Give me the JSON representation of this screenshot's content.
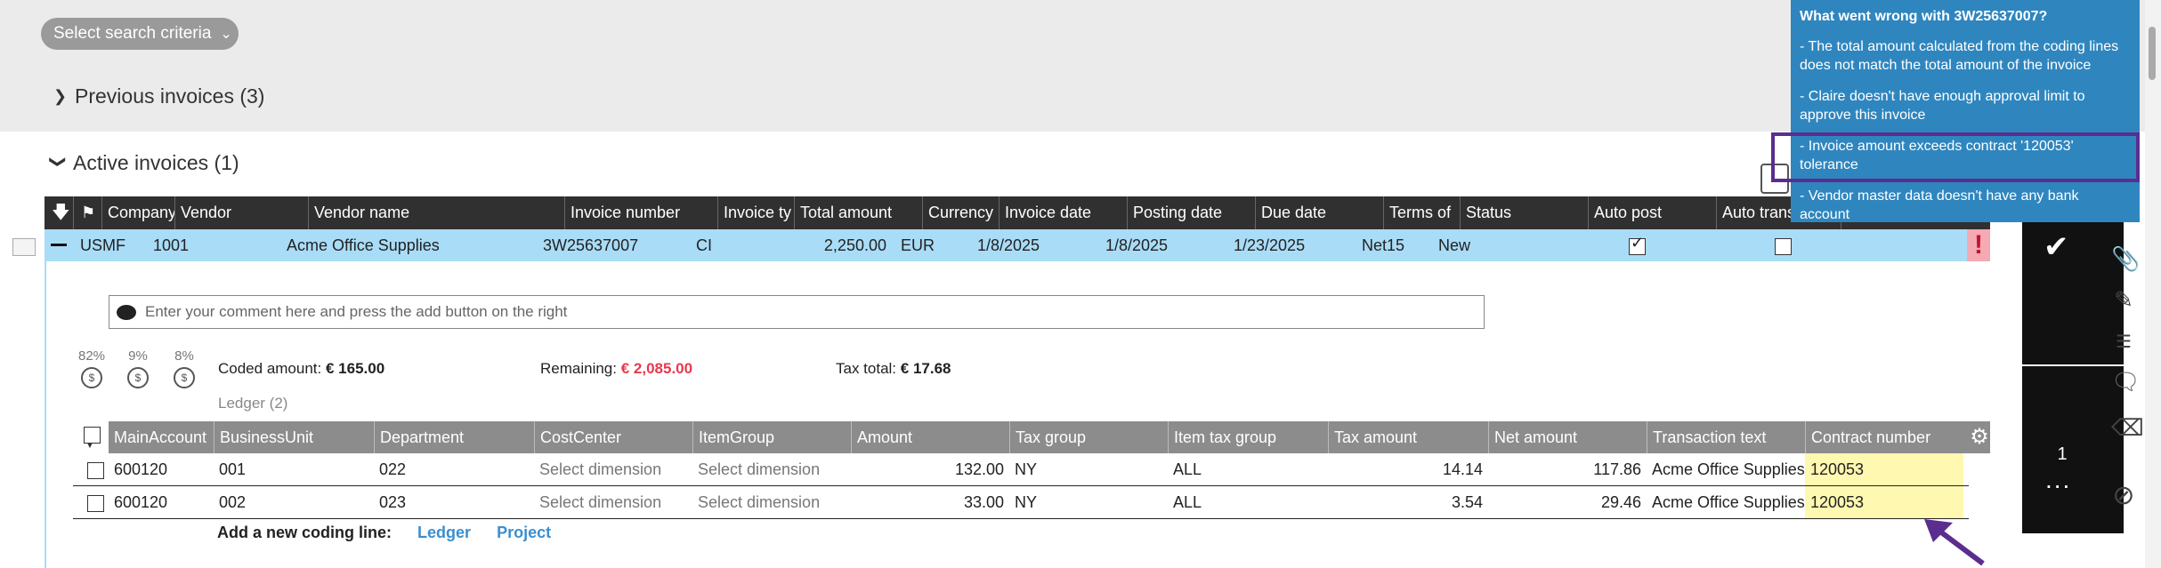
{
  "search": {
    "criteria_label": "Select search criteria"
  },
  "sections": {
    "previous": "Previous invoices (3)",
    "active": "Active invoices (1)"
  },
  "invoice_table": {
    "headers": [
      "Company",
      "Vendor",
      "Vendor name",
      "Invoice number",
      "Invoice ty",
      "Total amount",
      "Currency",
      "Invoice date",
      "Posting date",
      "Due date",
      "Terms of",
      "Status",
      "Auto post",
      "Auto trans"
    ],
    "row": {
      "company": "USMF",
      "vendor": "1001",
      "vendor_name": "Acme Office Supplies",
      "invoice_number": "3W25637007",
      "invoice_type": "CI",
      "total_amount": "2,250.00",
      "currency": "EUR",
      "invoice_date": "1/8/2025",
      "posting_date": "1/8/2025",
      "due_date": "1/23/2025",
      "terms": "Net15",
      "status": "New",
      "auto_post_checked": true,
      "auto_trans_checked": false,
      "warning_glyph": "!"
    }
  },
  "comment": {
    "placeholder": "Enter your comment here and press the add button on the right"
  },
  "summary": {
    "percentages": [
      "82%",
      "9%",
      "8%"
    ],
    "coded_label": "Coded amount:",
    "coded_value": "€ 165.00",
    "remaining_label": "Remaining:",
    "remaining_value": "€ 2,085.00",
    "tax_label": "Tax total:",
    "tax_value": "€ 17.68",
    "remaining_color": "#e8394d"
  },
  "ledger": {
    "label": "Ledger (2)",
    "headers": [
      "MainAccount",
      "BusinessUnit",
      "Department",
      "CostCenter",
      "ItemGroup",
      "Amount",
      "Tax group",
      "Item tax group",
      "Tax amount",
      "Net amount",
      "Transaction text",
      "Contract number"
    ],
    "rows": [
      {
        "main_account": "600120",
        "business_unit": "001",
        "department": "022",
        "cost_center": "Select dimension",
        "item_group": "Select dimension",
        "amount": "132.00",
        "tax_group": "NY",
        "item_tax_group": "ALL",
        "tax_amount": "14.14",
        "net_amount": "117.86",
        "transaction_text": "Acme Office Supplies",
        "contract_number": "120053"
      },
      {
        "main_account": "600120",
        "business_unit": "002",
        "department": "023",
        "cost_center": "Select dimension",
        "item_group": "Select dimension",
        "amount": "33.00",
        "tax_group": "NY",
        "item_tax_group": "ALL",
        "tax_amount": "3.54",
        "net_amount": "29.46",
        "transaction_text": "Acme Office Supplies",
        "contract_number": "120053"
      }
    ],
    "add_line_label": "Add a new coding line:",
    "add_ledger_link": "Ledger",
    "add_project_link": "Project"
  },
  "toolbar": {
    "count": "1",
    "more_glyph": "..."
  },
  "popup": {
    "title": "What went wrong with 3W25637007?",
    "items": [
      "- The total amount calculated from the coding lines does not match the total amount of the invoice",
      "- Claire doesn't have enough approval limit to approve this invoice",
      "- Invoice amount exceeds contract '120053' tolerance",
      "- Vendor master data doesn't have any bank account"
    ]
  },
  "colors": {
    "selected_row": "#a9dcf7",
    "popup_bg": "#2f86bf",
    "highlight_border": "#5b2d8e",
    "contract_cell": "#fff8b0"
  }
}
